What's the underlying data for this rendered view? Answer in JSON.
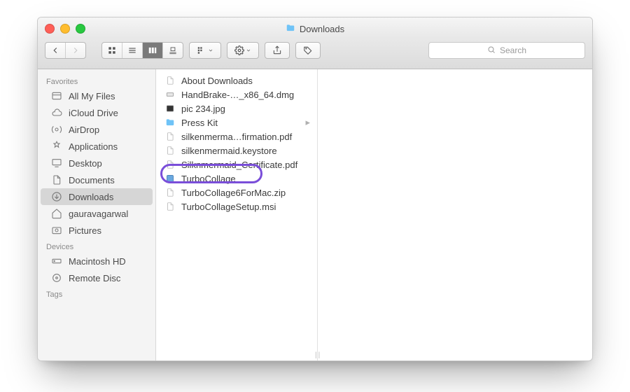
{
  "title": "Downloads",
  "search_placeholder": "Search",
  "sidebar": {
    "sections": [
      {
        "header": "Favorites",
        "items": [
          {
            "label": "All My Files",
            "icon": "all-my-files-icon"
          },
          {
            "label": "iCloud Drive",
            "icon": "cloud-icon"
          },
          {
            "label": "AirDrop",
            "icon": "airdrop-icon"
          },
          {
            "label": "Applications",
            "icon": "applications-icon"
          },
          {
            "label": "Desktop",
            "icon": "desktop-icon"
          },
          {
            "label": "Documents",
            "icon": "documents-icon"
          },
          {
            "label": "Downloads",
            "icon": "downloads-icon",
            "selected": true
          },
          {
            "label": "gauravagarwal",
            "icon": "home-icon"
          },
          {
            "label": "Pictures",
            "icon": "pictures-icon"
          }
        ]
      },
      {
        "header": "Devices",
        "items": [
          {
            "label": "Macintosh HD",
            "icon": "hdd-icon"
          },
          {
            "label": "Remote Disc",
            "icon": "disc-icon"
          }
        ]
      },
      {
        "header": "Tags",
        "items": []
      }
    ]
  },
  "column_items": [
    {
      "label": "About Downloads",
      "icon": "doc"
    },
    {
      "label": "HandBrake-…_x86_64.dmg",
      "icon": "dmg"
    },
    {
      "label": "pic 234.jpg",
      "icon": "img"
    },
    {
      "label": "Press Kit",
      "icon": "folder",
      "is_folder": true
    },
    {
      "label": "silkenmerma…firmation.pdf",
      "icon": "doc"
    },
    {
      "label": "silkenmermaid.keystore",
      "icon": "doc"
    },
    {
      "label": "Silknmermaid_Certificate.pdf",
      "icon": "doc"
    },
    {
      "label": "TurboCollage",
      "icon": "app",
      "highlight": true
    },
    {
      "label": "TurboCollage6ForMac.zip",
      "icon": "doc"
    },
    {
      "label": "TurboCollageSetup.msi",
      "icon": "doc"
    }
  ]
}
